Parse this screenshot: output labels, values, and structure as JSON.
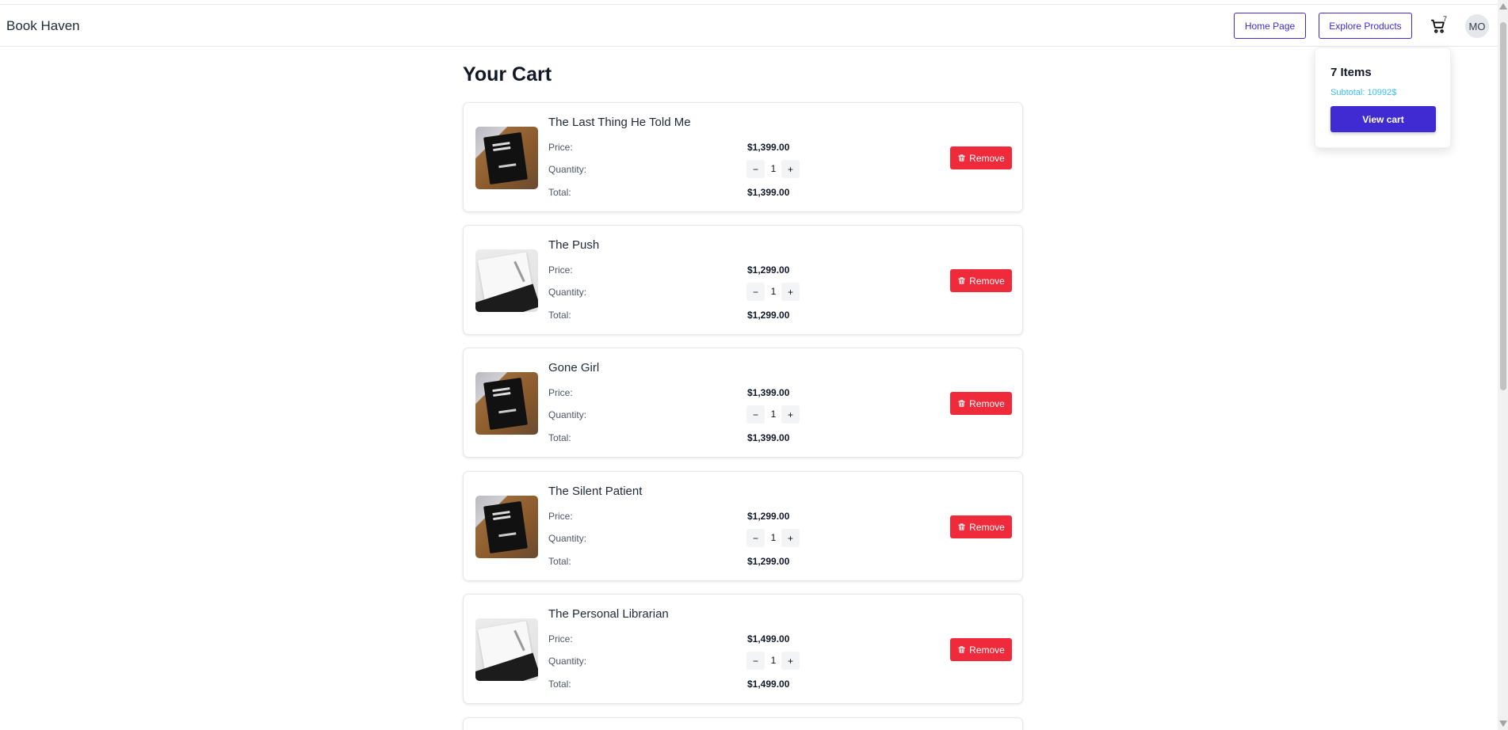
{
  "app": {
    "brand": "Book Haven"
  },
  "nav": {
    "home_label": "Home Page",
    "explore_label": "Explore Products",
    "cart_count": "7",
    "avatar_initials": "MO"
  },
  "cart_dropdown": {
    "items_label": "7 Items",
    "subtotal_label": "Subtotal: 10992$",
    "view_cart_label": "View cart"
  },
  "page": {
    "title": "Your Cart"
  },
  "labels": {
    "price": "Price:",
    "quantity": "Quantity:",
    "total": "Total:",
    "remove": "Remove",
    "minus": "−",
    "plus": "+"
  },
  "items": [
    {
      "title": "The Last Thing He Told Me",
      "price": "$1,399.00",
      "quantity": "1",
      "total": "$1,399.00",
      "image": "dark-book-image"
    },
    {
      "title": "The Push",
      "price": "$1,299.00",
      "quantity": "1",
      "total": "$1,299.00",
      "image": "white-notebook-image"
    },
    {
      "title": "Gone Girl",
      "price": "$1,399.00",
      "quantity": "1",
      "total": "$1,399.00",
      "image": "dark-book-image"
    },
    {
      "title": "The Silent Patient",
      "price": "$1,299.00",
      "quantity": "1",
      "total": "$1,299.00",
      "image": "dark-book-image"
    },
    {
      "title": "The Personal Librarian",
      "price": "$1,499.00",
      "quantity": "1",
      "total": "$1,499.00",
      "image": "white-notebook-image"
    }
  ],
  "colors": {
    "accent": "#3f2bd1",
    "remove": "#ef2b3b",
    "subtotal": "#38bdf8"
  }
}
